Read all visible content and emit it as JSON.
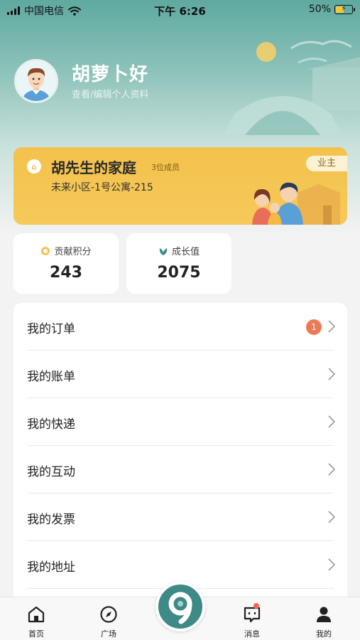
{
  "status_bar": {
    "carrier": "中国电信",
    "time": "下午 6:26",
    "battery": "50%",
    "battery_level": 0.5
  },
  "profile": {
    "greeting": "胡萝卜好",
    "edit_link": "查看/编辑个人资料"
  },
  "family": {
    "name": "胡先生的家庭",
    "member_count": "3位成员",
    "address": "未来小区-1号公寓-215",
    "role_tag": "业主"
  },
  "stats": [
    {
      "label": "贡献积分",
      "value": "243",
      "icon": "coin-icon"
    },
    {
      "label": "成长值",
      "value": "2075",
      "icon": "sprout-icon"
    }
  ],
  "menu": [
    {
      "label": "我的订单",
      "badge": "1"
    },
    {
      "label": "我的账单"
    },
    {
      "label": "我的快递"
    },
    {
      "label": "我的互动"
    },
    {
      "label": "我的发票"
    },
    {
      "label": "我的地址"
    }
  ],
  "nav": {
    "home": "首页",
    "square": "广场",
    "messages": "消息",
    "mine": "我的"
  },
  "colors": {
    "accent": "#3e8a86",
    "family_card": "#f5c44f",
    "badge": "#ee7a55"
  }
}
